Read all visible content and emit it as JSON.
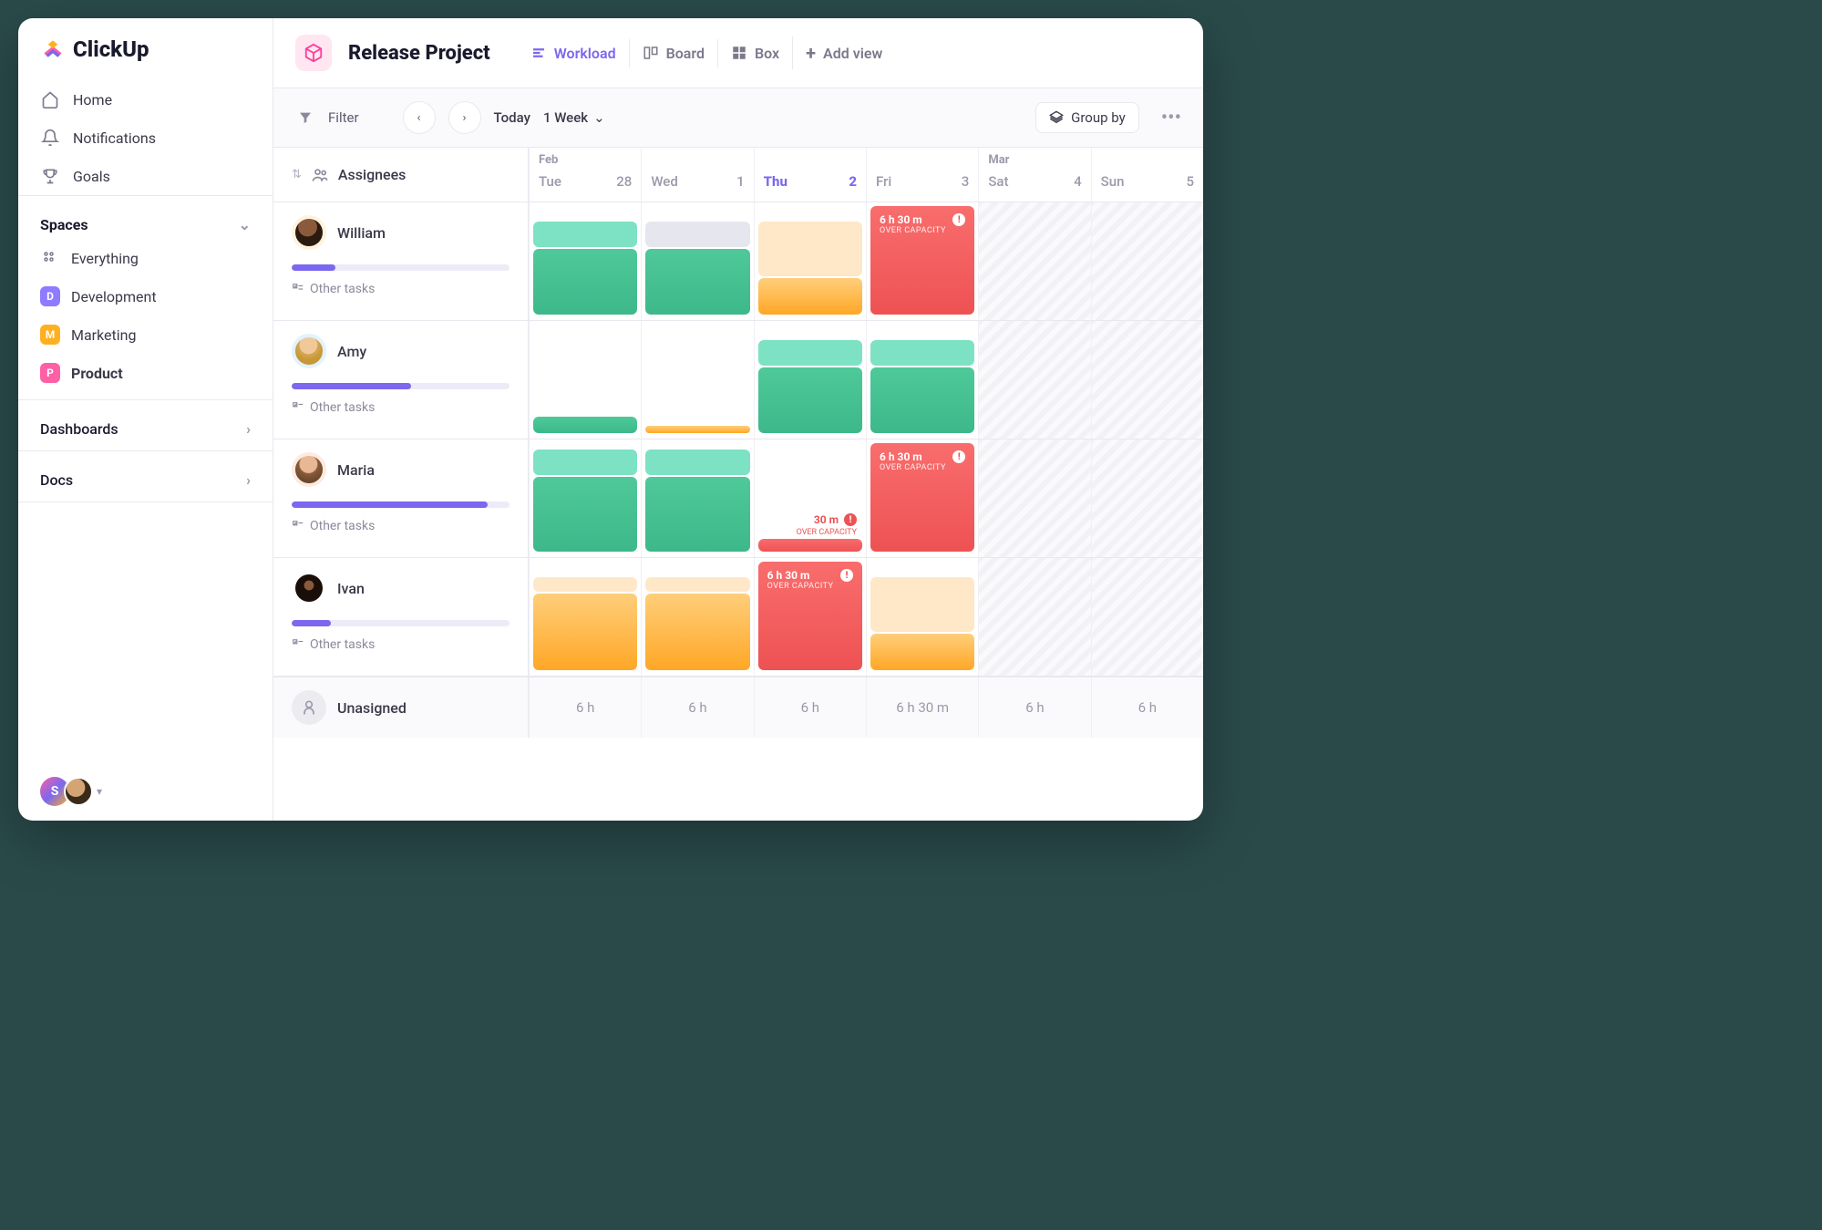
{
  "brand": "ClickUp",
  "nav": {
    "home": "Home",
    "notifications": "Notifications",
    "goals": "Goals"
  },
  "spaces": {
    "title": "Spaces",
    "everything": "Everything",
    "items": [
      {
        "letter": "D",
        "color": "#8e7bff",
        "label": "Development"
      },
      {
        "letter": "M",
        "color": "#ffb020",
        "label": "Marketing"
      },
      {
        "letter": "P",
        "color": "#ff5fa5",
        "label": "Product"
      }
    ]
  },
  "dashboards": "Dashboards",
  "docs": "Docs",
  "project": {
    "title": "Release Project"
  },
  "tabs": {
    "workload": "Workload",
    "board": "Board",
    "box": "Box",
    "add": "Add view"
  },
  "toolbar": {
    "filter": "Filter",
    "today": "Today",
    "range": "1 Week",
    "groupby": "Group by"
  },
  "columns": {
    "assignees": "Assignees"
  },
  "dates": [
    {
      "month": "Feb",
      "day": "Tue",
      "num": "28"
    },
    {
      "month": "",
      "day": "Wed",
      "num": "1"
    },
    {
      "month": "",
      "day": "Thu",
      "num": "2",
      "today": true
    },
    {
      "month": "",
      "day": "Fri",
      "num": "3"
    },
    {
      "month": "Mar",
      "day": "Sat",
      "num": "4",
      "weekend": true
    },
    {
      "month": "",
      "day": "Sun",
      "num": "5",
      "weekend": true
    }
  ],
  "other_tasks_label": "Other tasks",
  "over_capacity": "OVER CAPACITY",
  "assignees": {
    "william": {
      "name": "William",
      "progress": 20
    },
    "amy": {
      "name": "Amy",
      "progress": 55
    },
    "maria": {
      "name": "Maria",
      "progress": 90
    },
    "ivan": {
      "name": "Ivan",
      "progress": 18
    },
    "unassigned": {
      "name": "Unasigned"
    }
  },
  "overcap": {
    "t630": "6 h 30 m",
    "t30": "30 m"
  },
  "footer": {
    "c1": "6 h",
    "c2": "6 h",
    "c3": "6 h",
    "c4": "6 h  30 m",
    "c5": "6 h",
    "c6": "6 h"
  }
}
